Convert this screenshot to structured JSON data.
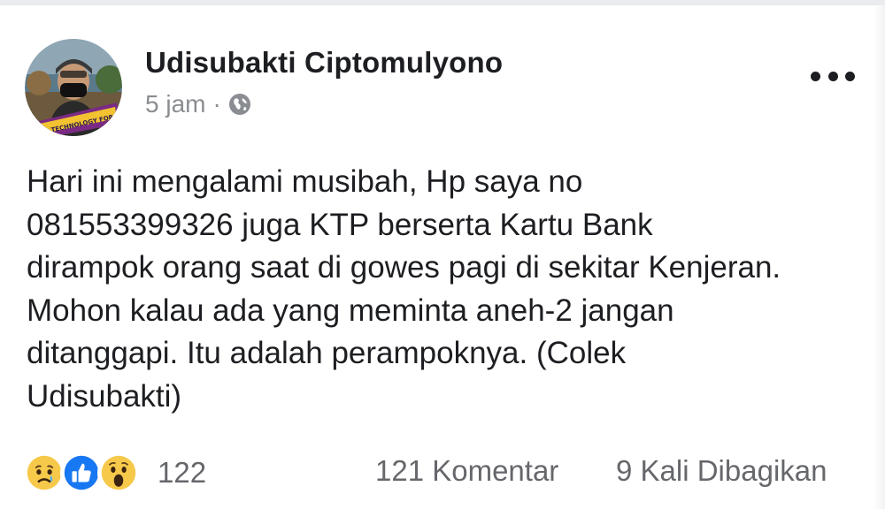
{
  "post": {
    "author": "Udisubakti Ciptomulyono",
    "time": "5 jam",
    "separator": "·",
    "privacy_icon": "globe-icon",
    "more_icon": "more-dots-icon",
    "avatar_badge_text": "TECHNOLOGY FOR PROSPERITY",
    "body": "Hari ini mengalami musibah, Hp saya no\n081553399326 juga KTP berserta Kartu Bank\ndirampok orang saat di gowes pagi di sekitar Kenjeran.\nMohon kalau ada yang meminta aneh-2 jangan\nditanggapi. Itu adalah perampoknya. (Colek\nUdisubakti)"
  },
  "footer": {
    "reaction_icons": [
      "sad-icon",
      "like-icon",
      "wow-icon"
    ],
    "reaction_count": "122",
    "comments": "121 Komentar",
    "shares": "9 Kali Dibagikan"
  },
  "colors": {
    "text": "#1c1e21",
    "secondary": "#65676b",
    "like_blue": "#1877f2",
    "emoji_yellow": "#f7c94b"
  }
}
